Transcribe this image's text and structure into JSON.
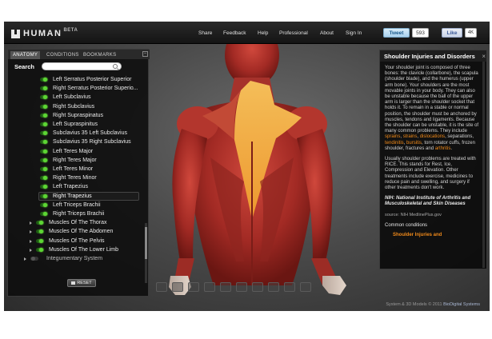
{
  "app": {
    "name": "HUMAN",
    "badge": "BETA"
  },
  "nav": [
    "Share",
    "Feedback",
    "Help",
    "Professional",
    "About",
    "Sign In"
  ],
  "social": {
    "tweet_label": "Tweet",
    "tweet_count": "593",
    "like_label": "Like",
    "like_count": "4K"
  },
  "left_panel": {
    "tabs": [
      {
        "label": "ANATOMY",
        "active": true
      },
      {
        "label": "CONDITIONS",
        "active": false
      },
      {
        "label": "BOOKMARKS",
        "active": false
      }
    ],
    "collapse_symbol": "–",
    "search_label": "Search",
    "search_value": "",
    "items": [
      {
        "label": "Left Serratus Posterior Superior",
        "kind": "muscle"
      },
      {
        "label": "Right Serratus Posterior Superio...",
        "kind": "muscle"
      },
      {
        "label": "Left Subclavius",
        "kind": "muscle"
      },
      {
        "label": "Right Subclavius",
        "kind": "muscle"
      },
      {
        "label": "Right Supraspinatus",
        "kind": "muscle"
      },
      {
        "label": "Left Supraspinitus",
        "kind": "muscle"
      },
      {
        "label": "Subclavius 35 Left Subclavius",
        "kind": "muscle"
      },
      {
        "label": "Subclavius 35 Right Subclavius",
        "kind": "muscle"
      },
      {
        "label": "Left Teres Major",
        "kind": "muscle"
      },
      {
        "label": "Right Teres Major",
        "kind": "muscle"
      },
      {
        "label": "Left Teres Minor",
        "kind": "muscle"
      },
      {
        "label": "Right Teres Minor",
        "kind": "muscle"
      },
      {
        "label": "Left Trapezius",
        "kind": "muscle"
      },
      {
        "label": "Right Trapezius",
        "kind": "muscle",
        "selected": true
      },
      {
        "label": "Left Triceps Brachii",
        "kind": "muscle"
      },
      {
        "label": "Right Triceps Brachii",
        "kind": "muscle"
      },
      {
        "label": "Muscles Of The Thorax",
        "kind": "group"
      },
      {
        "label": "Muscles Of The Abdomen",
        "kind": "group"
      },
      {
        "label": "Muscles Of The Pelvis",
        "kind": "group"
      },
      {
        "label": "Muscles Of The Lower Limb",
        "kind": "group"
      },
      {
        "label": "Integumentary System",
        "kind": "group-off"
      }
    ],
    "reset_label": "RESET"
  },
  "info_panel": {
    "title": "Shoulder Injuries and Disorders",
    "close_symbol": "×",
    "p1_a": "Your shoulder joint is composed of three bones: the clavicle (collarbone), the scapula (shoulder blade), and the humerus (upper arm bone). Your shoulders are the most movable joints in your body. They can also be unstable because the ball of the upper arm is larger than the shoulder socket that holds it. To remain in a stable or normal position, the shoulder must be anchored by muscles, tendons and ligaments. Because the shoulder can be unstable, it is the site of many common problems. They include ",
    "hl1": "sprains",
    "c1": ", ",
    "hl2": "strains",
    "c2": ", ",
    "hl3": "dislocations",
    "p1_b": ", separations, ",
    "hl4": "tendinitis",
    "c3": ", ",
    "hl5": "bursitis",
    "p1_c": ", torn rotator cuffs, frozen shoulder, fractures and ",
    "hl6": "arthritis",
    "p1_end": ".",
    "p2": "Usually shoulder problems are treated with RICE. This stands for Rest, Ice, Compression and Elevation. Other treatments include exercise, medicines to reduce pain and swelling, and surgery if other treatments don't work.",
    "nih": "NIH: National Institute of Arthritis and Musculoskeletal and Skin Diseases",
    "source": "source: NIH MedlinePlus.gov",
    "common_label": "Common conditions",
    "common_item": "Shoulder Injuries and"
  },
  "footer": {
    "prefix": "System & 3D Models © 2011 ",
    "link": "BioDigital Systems"
  },
  "colors": {
    "accent_orange": "#f08a1a",
    "toggle_on": "#5dd634",
    "muscle_red": "#b8372f",
    "trapezius_highlight": "#f3a63a"
  }
}
